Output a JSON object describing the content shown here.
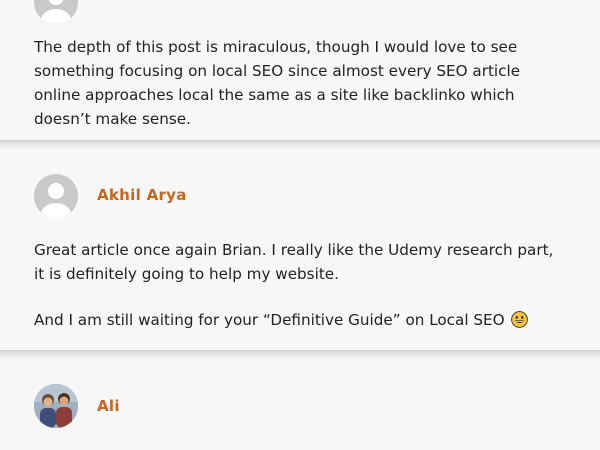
{
  "comments": [
    {
      "author": "",
      "paragraphs": [
        "The depth of this post is miraculous, though I would love to see something focusing on local SEO since almost every SEO article online approaches local the same as a site like backlinko which doesn’t make sense."
      ]
    },
    {
      "author": "Akhil Arya",
      "paragraphs": [
        "Great article once again Brian. I really like the Udemy research part, it is definitely going to help my website.",
        "And I am still waiting for your “Definitive Guide” on Local SEO"
      ],
      "emoji": "grinning-face-emoji"
    },
    {
      "author": "Ali",
      "paragraphs": []
    }
  ],
  "colors": {
    "author": "#c8661f",
    "text": "#222222",
    "background": "#f7f7f7"
  }
}
